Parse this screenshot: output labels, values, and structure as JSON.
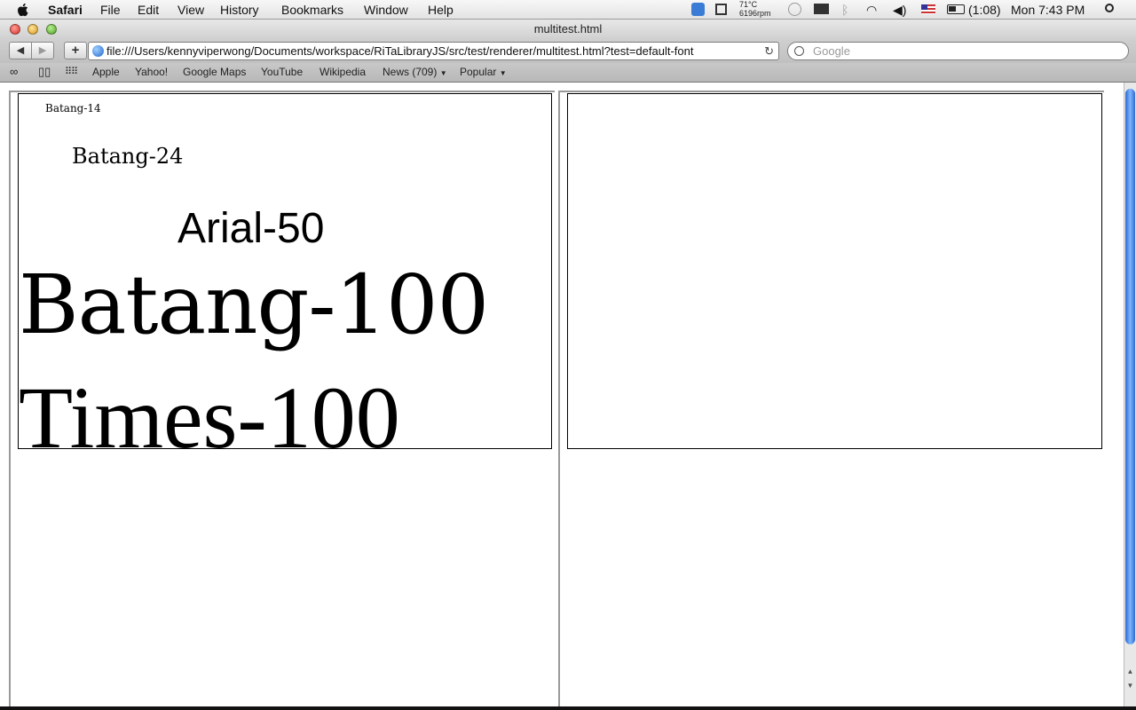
{
  "menubar": {
    "app": "Safari",
    "items": [
      "File",
      "Edit",
      "View",
      "History",
      "Bookmarks",
      "Window",
      "Help"
    ],
    "status": {
      "temperature": "71°C",
      "fan": "6196rpm",
      "battery": "(1:08)",
      "clock": "Mon 7:43 PM"
    }
  },
  "window": {
    "title": "multitest.html",
    "url": "file:///Users/kennyviperwong/Documents/workspace/RiTaLibraryJS/src/test/renderer/multitest.html?test=default-font",
    "search_placeholder": "Google",
    "add_label": "+"
  },
  "bookmarks": {
    "items": [
      "Apple",
      "Yahoo!",
      "Google Maps",
      "YouTube",
      "Wikipedia",
      "News (709)",
      "Popular"
    ]
  },
  "page": {
    "samples": [
      "Batang-14",
      "Batang-24",
      "Arial-50",
      "Batang-100",
      "Times-100"
    ]
  }
}
